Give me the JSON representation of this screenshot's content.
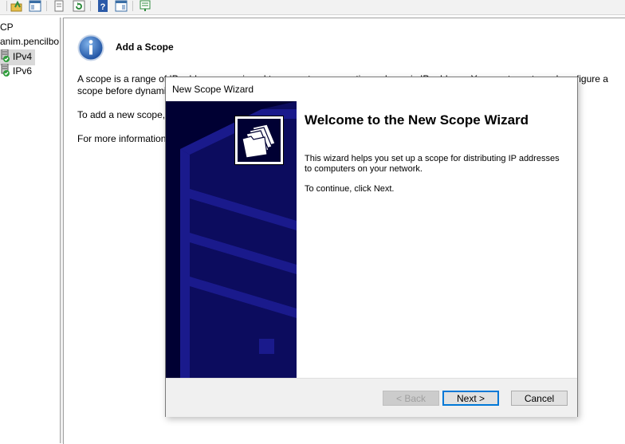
{
  "toolbar": {
    "icons": [
      "folder-up-icon",
      "show-hide-tree-icon",
      "properties-icon",
      "refresh-icon",
      "help-icon",
      "show-action-pane-icon",
      "export-list-icon"
    ]
  },
  "tree": {
    "items": [
      {
        "label": "CP",
        "icon": "none"
      },
      {
        "label": "anim.pencilbo",
        "icon": "none"
      },
      {
        "label": "IPv4",
        "icon": "ipv4-server-icon",
        "selected": true
      },
      {
        "label": "IPv6",
        "icon": "ipv6-server-icon"
      }
    ]
  },
  "pane": {
    "title": "Add a Scope",
    "line1": "A scope is a range of IP addresses assigned to computers requesting a dynamic IP address. You must create and configure a",
    "line2": "scope before dynamic IP addresses can be assigned.",
    "line3": "To add a new scope,",
    "line4": "For more information"
  },
  "wizard": {
    "window_title": "New Scope Wizard",
    "heading": "Welcome to the New Scope Wizard",
    "para1": "This wizard helps you set up a scope for distributing IP addresses to computers on your network.",
    "para2": "To continue, click Next.",
    "back_label": "< Back",
    "next_label": "Next >",
    "cancel_label": "Cancel"
  },
  "colors": {
    "panel_bg": "#000033",
    "panel_stripe": "#1a1a8c",
    "accent": "#0078d7"
  }
}
